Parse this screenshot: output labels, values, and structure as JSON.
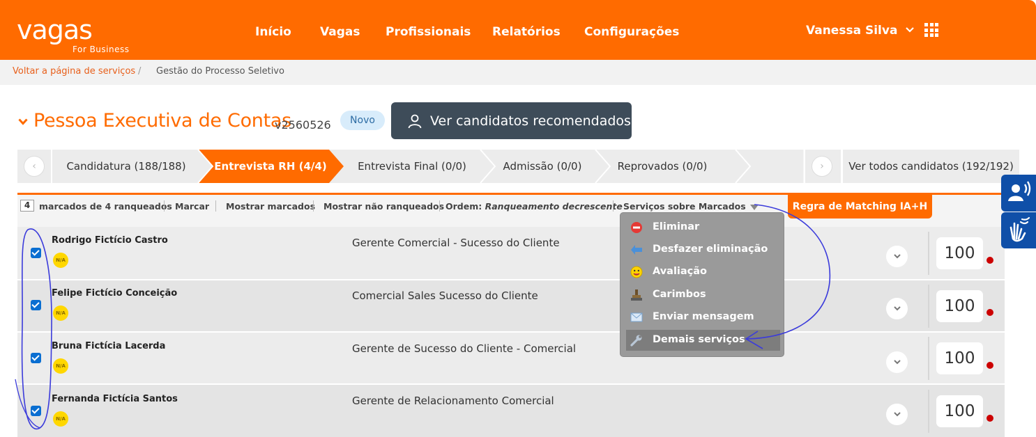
{
  "header": {
    "logo_word": "vagas",
    "logo_sub": "For Business",
    "nav": [
      "Início",
      "Vagas",
      "Profissionais",
      "Relatórios",
      "Configurações"
    ],
    "user_name": "Vanessa Silva"
  },
  "breadcrumb": {
    "back": "Voltar a página de serviços",
    "sep": "/",
    "current": "Gestão do Processo Seletivo"
  },
  "job": {
    "title": "Pessoa Executiva de Contas",
    "code": "v2560526",
    "badge": "Novo",
    "recommended_button": "Ver candidatos recomendados"
  },
  "tabs": [
    {
      "label": "Candidatura (188/188)",
      "active": false
    },
    {
      "label": "Entrevista RH (4/4)",
      "active": true
    },
    {
      "label": "Entrevista Final (0/0)",
      "active": false
    },
    {
      "label": "Admissão (0/0)",
      "active": false
    },
    {
      "label": "Reprovados (0/0)",
      "active": false
    }
  ],
  "all_tab": "Ver todos candidatos (192/192)",
  "toolbar": {
    "count": "4",
    "count_label": "marcados de 4 ranqueados",
    "mark": "Marcar",
    "show_marked": "Mostrar marcados",
    "show_unranked": "Mostrar não ranqueados",
    "order_label": "Ordem:",
    "order_value": "Ranqueamento decrescente",
    "services": "Serviços sobre Marcados",
    "matching_rule": "Regra de Matching IA+H"
  },
  "candidates": [
    {
      "name": "Rodrigo Fictício Castro",
      "badge": "N/A",
      "position": "Gerente Comercial - Sucesso do Cliente",
      "score": "100",
      "checked": true
    },
    {
      "name": "Felipe Fictício Conceição",
      "badge": "N/A",
      "position": "Comercial Sales Sucesso do Cliente",
      "score": "100",
      "checked": true
    },
    {
      "name": "Bruna Fictícia Lacerda",
      "badge": "N/A",
      "position": "Gerente de Sucesso do Cliente - Comercial",
      "score": "100",
      "checked": true
    },
    {
      "name": "Fernanda Fictícia Santos",
      "badge": "N/A",
      "position": "Gerente de Relacionamento Comercial",
      "score": "100",
      "checked": true
    }
  ],
  "services_menu": [
    {
      "label": "Eliminar",
      "icon": "eliminate-icon"
    },
    {
      "label": "Desfazer eliminação",
      "icon": "undo-arrow-icon"
    },
    {
      "label": "Avaliação",
      "icon": "smiley-icon"
    },
    {
      "label": "Carimbos",
      "icon": "stamp-icon"
    },
    {
      "label": "Enviar mensagem",
      "icon": "envelope-icon"
    },
    {
      "label": "Demais serviços",
      "icon": "wrench-icon",
      "highlighted": true
    }
  ],
  "colors": {
    "brand_orange": "#ff6b00",
    "dark_button": "#3e4c59",
    "checkbox_blue": "#0a6ed1",
    "annotation_blue": "#3b3bdb",
    "accessibility_blue": "#0f4fa8"
  }
}
